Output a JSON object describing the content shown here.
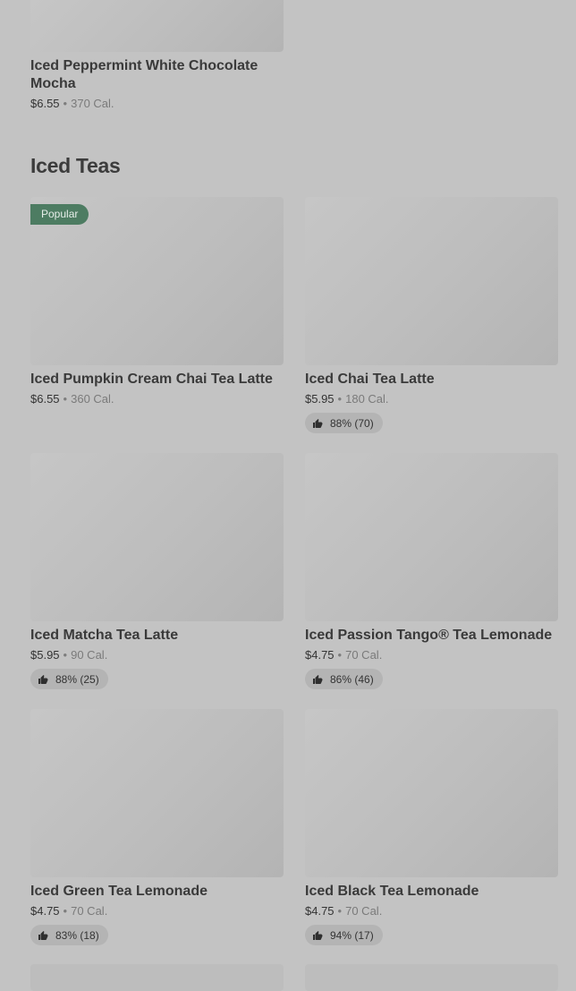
{
  "top_item": {
    "name": "Iced Peppermint White Chocolate Mocha",
    "price": "$6.55",
    "separator": "•",
    "calories": "370 Cal."
  },
  "section": {
    "title": "Iced Teas"
  },
  "items": [
    {
      "name": "Iced Pumpkin Cream Chai Tea Latte",
      "price": "$6.55",
      "separator": "•",
      "calories": "360 Cal.",
      "badge": "Popular",
      "rating": ""
    },
    {
      "name": "Iced Chai Tea Latte",
      "price": "$5.95",
      "separator": "•",
      "calories": "180 Cal.",
      "rating": "88% (70)",
      "rating_icon": "thumbs-up-icon"
    },
    {
      "name": "Iced Matcha Tea Latte",
      "price": "$5.95",
      "separator": "•",
      "calories": "90 Cal.",
      "rating": "88% (25)",
      "rating_icon": "thumbs-up-icon"
    },
    {
      "name": "Iced Passion Tango® Tea Lemonade",
      "price": "$4.75",
      "separator": "•",
      "calories": "70 Cal.",
      "rating": "86% (46)",
      "rating_icon": "thumbs-up-icon"
    },
    {
      "name": "Iced Green Tea Lemonade",
      "price": "$4.75",
      "separator": "•",
      "calories": "70 Cal.",
      "rating": "83% (18)",
      "rating_icon": "thumbs-up-icon"
    },
    {
      "name": "Iced Black Tea Lemonade",
      "price": "$4.75",
      "separator": "•",
      "calories": "70 Cal.",
      "rating": "94% (17)",
      "rating_icon": "thumbs-up-icon"
    }
  ],
  "colors": {
    "background": "#c3c3c3",
    "popular_badge": "#4d7c62",
    "rating_pill": "#b4b4b4"
  }
}
